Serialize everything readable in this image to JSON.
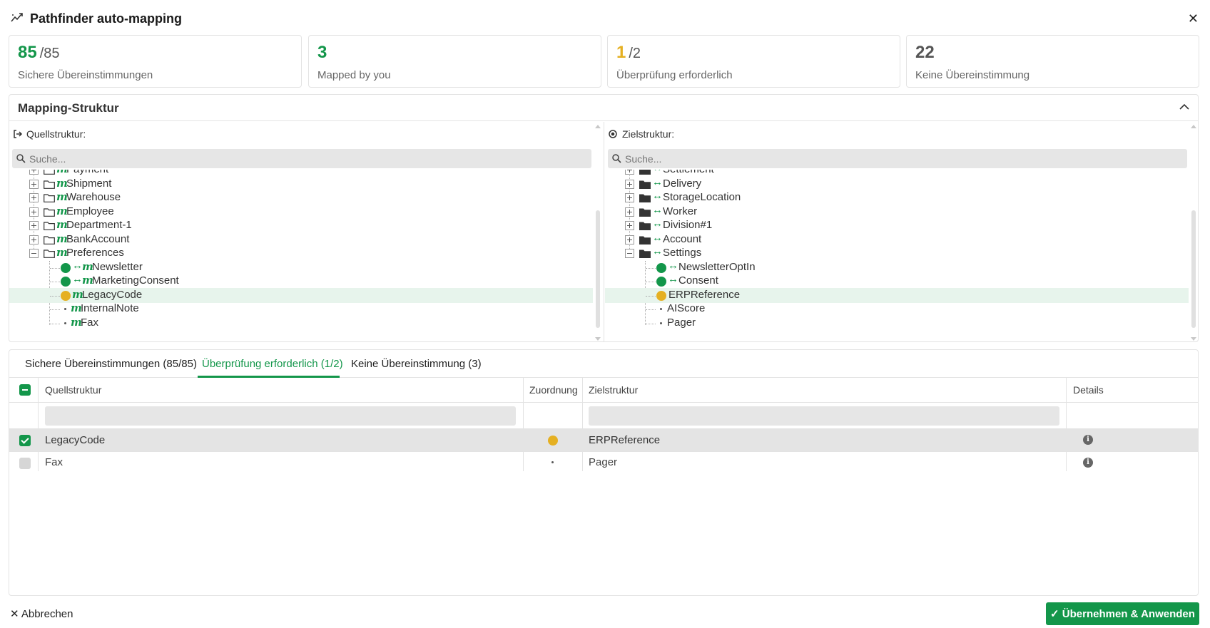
{
  "header": {
    "title": "Pathfinder auto-mapping",
    "close_icon": "close-icon"
  },
  "stats": [
    {
      "value": "85",
      "total": "/85",
      "label": "Sichere Übereinstimmungen",
      "color": "#13964a"
    },
    {
      "value": "3",
      "total": "",
      "label": "Mapped by you",
      "color": "#13964a"
    },
    {
      "value": "1",
      "total": "/2",
      "label": "Überprüfung erforderlich",
      "color": "#e5b022"
    },
    {
      "value": "22",
      "total": "",
      "label": "Keine Übereinstimmung",
      "color": "#555555"
    }
  ],
  "mapping": {
    "title": "Mapping-Struktur",
    "source": {
      "label": "Quellstruktur:",
      "search_placeholder": "Suche...",
      "items": [
        {
          "label": "Payment",
          "type": "collapsed-folder"
        },
        {
          "label": "Shipment",
          "type": "collapsed-folder"
        },
        {
          "label": "Warehouse",
          "type": "collapsed-folder"
        },
        {
          "label": "Employee",
          "type": "collapsed-folder"
        },
        {
          "label": "Department-1",
          "type": "collapsed-folder"
        },
        {
          "label": "BankAccount",
          "type": "collapsed-folder"
        },
        {
          "label": "Preferences",
          "type": "expanded-folder"
        },
        {
          "label": "Newsletter",
          "status": "matched"
        },
        {
          "label": "MarketingConsent",
          "status": "matched"
        },
        {
          "label": "LegacyCode",
          "status": "review"
        },
        {
          "label": "InternalNote",
          "status": "none"
        },
        {
          "label": "Fax",
          "status": "none"
        }
      ]
    },
    "target": {
      "label": "Zielstruktur:",
      "search_placeholder": "Suche...",
      "items": [
        {
          "label": "Settlement",
          "type": "collapsed-folder"
        },
        {
          "label": "Delivery",
          "type": "collapsed-folder"
        },
        {
          "label": "StorageLocation",
          "type": "collapsed-folder"
        },
        {
          "label": "Worker",
          "type": "collapsed-folder"
        },
        {
          "label": "Division#1",
          "type": "collapsed-folder"
        },
        {
          "label": "Account",
          "type": "collapsed-folder"
        },
        {
          "label": "Settings",
          "type": "expanded-folder"
        },
        {
          "label": "NewsletterOptIn",
          "status": "matched"
        },
        {
          "label": "Consent",
          "status": "matched"
        },
        {
          "label": "ERPReference",
          "status": "review"
        },
        {
          "label": "AIScore",
          "status": "none"
        },
        {
          "label": "Pager",
          "status": "none"
        }
      ]
    }
  },
  "tabs": [
    {
      "label": "Sichere Übereinstimmungen (85/85)"
    },
    {
      "label": "Überprüfung erforderlich (1/2)"
    },
    {
      "label": "Keine Übereinstimmung (3)"
    }
  ],
  "table": {
    "columns": [
      "Quellstruktur",
      "Zuordnung",
      "Zielstruktur",
      "Details"
    ],
    "rows": [
      {
        "source": "LegacyCode",
        "target": "ERPReference",
        "checked": true,
        "status": "review"
      },
      {
        "source": "Fax",
        "target": "Pager",
        "checked": false,
        "status": "none"
      }
    ]
  },
  "footer": {
    "cancel_label": "Abbrechen",
    "apply_label": "Übernehmen & Anwenden"
  },
  "colors": {
    "accent": "#13964a",
    "review": "#e5b022",
    "highlight_row": "#e7f4ec"
  }
}
